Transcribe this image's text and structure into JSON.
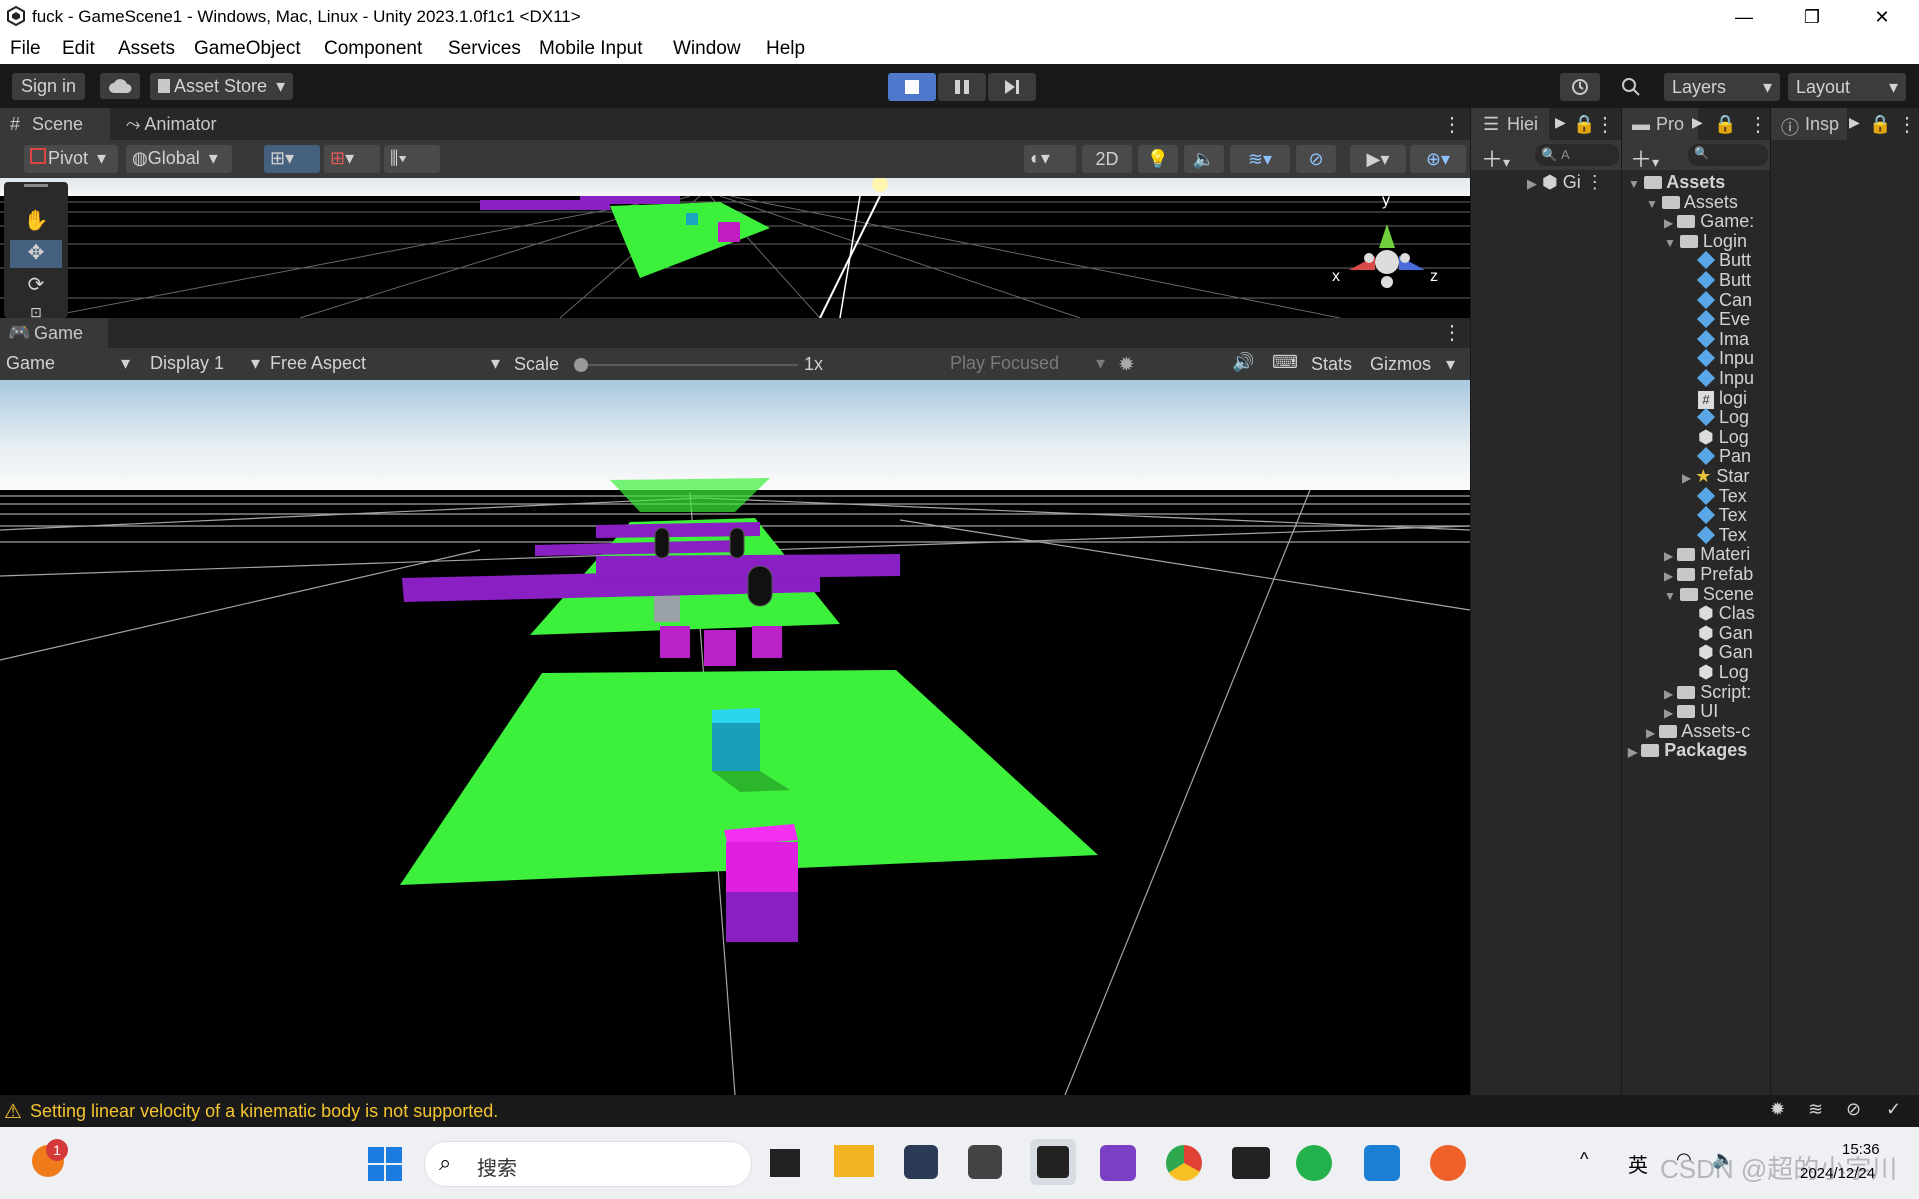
{
  "window": {
    "title": "fuck - GameScene1 - Windows, Mac, Linux - Unity 2023.1.0f1c1 <DX11>",
    "minimize": "—",
    "maximize": "❐",
    "close": "✕"
  },
  "menu": [
    "File",
    "Edit",
    "Assets",
    "GameObject",
    "Component",
    "Services",
    "Mobile Input",
    "Window",
    "Help"
  ],
  "toolbar": {
    "sign_in": "Sign in",
    "asset_store": "Asset Store",
    "layers": "Layers",
    "layout": "Layout"
  },
  "scene_tabs": {
    "scene": "Scene",
    "animator": "Animator"
  },
  "scene_toolbar": {
    "pivot": "Pivot",
    "global": "Global",
    "two_d": "2D"
  },
  "gizmo_axes": {
    "x": "x",
    "y": "y",
    "z": "z"
  },
  "game_tab": {
    "label": "Game"
  },
  "game_toolbar": {
    "game": "Game",
    "display": "Display 1",
    "aspect": "Free Aspect",
    "scale_label": "Scale",
    "scale_value": "1x",
    "play_focused": "Play Focused",
    "stats": "Stats",
    "gizmos": "Gizmos",
    "scale_fraction": 0.0
  },
  "hierarchy": {
    "tab": "Hiei",
    "search_hint": "A",
    "scene_item": "Gi"
  },
  "project": {
    "tab": "Pro",
    "tree": [
      {
        "label": "Assets",
        "indent": 0,
        "type": "folder",
        "arrow": "▼",
        "bold": true
      },
      {
        "label": "Assets",
        "indent": 1,
        "type": "folder",
        "arrow": "▼"
      },
      {
        "label": "Game:",
        "indent": 2,
        "type": "folder",
        "arrow": "▶"
      },
      {
        "label": "Login",
        "indent": 2,
        "type": "folder",
        "arrow": "▼"
      },
      {
        "label": "Butt",
        "indent": 3,
        "type": "prefab",
        "arrow": ""
      },
      {
        "label": "Butt",
        "indent": 3,
        "type": "prefab",
        "arrow": ""
      },
      {
        "label": "Can",
        "indent": 3,
        "type": "prefab",
        "arrow": ""
      },
      {
        "label": "Eve",
        "indent": 3,
        "type": "prefab",
        "arrow": ""
      },
      {
        "label": "Ima",
        "indent": 3,
        "type": "prefab",
        "arrow": ""
      },
      {
        "label": "Inpu",
        "indent": 3,
        "type": "prefab",
        "arrow": ""
      },
      {
        "label": "Inpu",
        "indent": 3,
        "type": "prefab",
        "arrow": ""
      },
      {
        "label": "logi",
        "indent": 3,
        "type": "script",
        "arrow": ""
      },
      {
        "label": "Log",
        "indent": 3,
        "type": "prefab",
        "arrow": ""
      },
      {
        "label": "Log",
        "indent": 3,
        "type": "scene",
        "arrow": ""
      },
      {
        "label": "Pan",
        "indent": 3,
        "type": "prefab",
        "arrow": ""
      },
      {
        "label": "Star",
        "indent": 3,
        "type": "star",
        "arrow": "▶"
      },
      {
        "label": "Tex",
        "indent": 3,
        "type": "prefab",
        "arrow": ""
      },
      {
        "label": "Tex",
        "indent": 3,
        "type": "prefab",
        "arrow": ""
      },
      {
        "label": "Tex",
        "indent": 3,
        "type": "prefab",
        "arrow": ""
      },
      {
        "label": "Materi",
        "indent": 2,
        "type": "folder",
        "arrow": "▶"
      },
      {
        "label": "Prefab",
        "indent": 2,
        "type": "folder",
        "arrow": "▶"
      },
      {
        "label": "Scene",
        "indent": 2,
        "type": "folder",
        "arrow": "▼"
      },
      {
        "label": "Clas",
        "indent": 3,
        "type": "scene",
        "arrow": ""
      },
      {
        "label": "Gan",
        "indent": 3,
        "type": "scene",
        "arrow": ""
      },
      {
        "label": "Gan",
        "indent": 3,
        "type": "scene",
        "arrow": ""
      },
      {
        "label": "Log",
        "indent": 3,
        "type": "scene",
        "arrow": ""
      },
      {
        "label": "Script:",
        "indent": 2,
        "type": "folder",
        "arrow": "▶"
      },
      {
        "label": "UI",
        "indent": 2,
        "type": "folder",
        "arrow": "▶"
      },
      {
        "label": "Assets-c",
        "indent": 1,
        "type": "folder",
        "arrow": "▶"
      },
      {
        "label": "Packages",
        "indent": 0,
        "type": "folder",
        "arrow": "▶",
        "bold": true
      }
    ]
  },
  "inspector": {
    "tab": "Insp"
  },
  "status": {
    "message": "Setting linear velocity of a kinematic body is not supported."
  },
  "taskbar": {
    "search": "搜索",
    "badge": "1",
    "ime": "英",
    "time": "15:36",
    "date": "2024/12/24",
    "watermark": "CSDN @超的小宇川"
  },
  "colors": {
    "accent": "#4d78cc",
    "warning": "#f4c430",
    "ground": "#3cf03c",
    "purple": "#8a1fc4",
    "magenta": "#e020e0",
    "cyan": "#1aa6bf"
  }
}
